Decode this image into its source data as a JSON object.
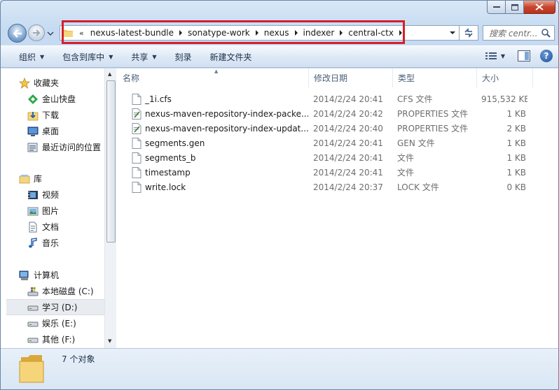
{
  "window": {
    "caption_buttons": [
      "minimize",
      "maximize",
      "close"
    ]
  },
  "address": {
    "overflow_chevron": "«",
    "crumbs": [
      "nexus-latest-bundle",
      "sonatype-work",
      "nexus",
      "indexer",
      "central-ctx"
    ],
    "highlight_color": "#d41f2a"
  },
  "search": {
    "placeholder": "搜索 centr..."
  },
  "toolbar": {
    "organize": "组织",
    "include_in_library": "包含到库中",
    "share": "共享",
    "burn": "刻录",
    "new_folder": "新建文件夹"
  },
  "sidebar": {
    "favorites": {
      "label": "收藏夹",
      "items": [
        {
          "label": "金山快盘",
          "icon": "kuaipan-icon"
        },
        {
          "label": "下载",
          "icon": "download-folder-icon"
        },
        {
          "label": "桌面",
          "icon": "desktop-icon"
        },
        {
          "label": "最近访问的位置",
          "icon": "recent-places-icon"
        }
      ]
    },
    "libraries": {
      "label": "库",
      "items": [
        {
          "label": "视频",
          "icon": "video-icon"
        },
        {
          "label": "图片",
          "icon": "pictures-icon"
        },
        {
          "label": "文档",
          "icon": "documents-icon"
        },
        {
          "label": "音乐",
          "icon": "music-icon"
        }
      ]
    },
    "computer": {
      "label": "计算机",
      "items": [
        {
          "label": "本地磁盘 (C:)",
          "icon": "system-drive-icon"
        },
        {
          "label": "学习 (D:)",
          "icon": "drive-icon",
          "selected": true
        },
        {
          "label": "娱乐 (E:)",
          "icon": "drive-icon"
        },
        {
          "label": "其他 (F:)",
          "icon": "drive-icon"
        }
      ]
    }
  },
  "columns": {
    "name": "名称",
    "date": "修改日期",
    "type": "类型",
    "size": "大小"
  },
  "files": [
    {
      "name": "_1i.cfs",
      "date": "2014/2/24 20:41",
      "type": "CFS 文件",
      "size": "915,532 KB",
      "icon": "file-icon"
    },
    {
      "name": "nexus-maven-repository-index-packe...",
      "date": "2014/2/24 20:42",
      "type": "PROPERTIES 文件",
      "size": "1 KB",
      "icon": "properties-file-icon"
    },
    {
      "name": "nexus-maven-repository-index-updat...",
      "date": "2014/2/24 20:40",
      "type": "PROPERTIES 文件",
      "size": "2 KB",
      "icon": "properties-file-icon"
    },
    {
      "name": "segments.gen",
      "date": "2014/2/24 20:41",
      "type": "GEN 文件",
      "size": "1 KB",
      "icon": "file-icon"
    },
    {
      "name": "segments_b",
      "date": "2014/2/24 20:41",
      "type": "文件",
      "size": "1 KB",
      "icon": "file-icon"
    },
    {
      "name": "timestamp",
      "date": "2014/2/24 20:41",
      "type": "文件",
      "size": "1 KB",
      "icon": "file-icon"
    },
    {
      "name": "write.lock",
      "date": "2014/2/24 20:37",
      "type": "LOCK 文件",
      "size": "0 KB",
      "icon": "file-icon"
    }
  ],
  "details": {
    "count_text": "7 个对象"
  }
}
